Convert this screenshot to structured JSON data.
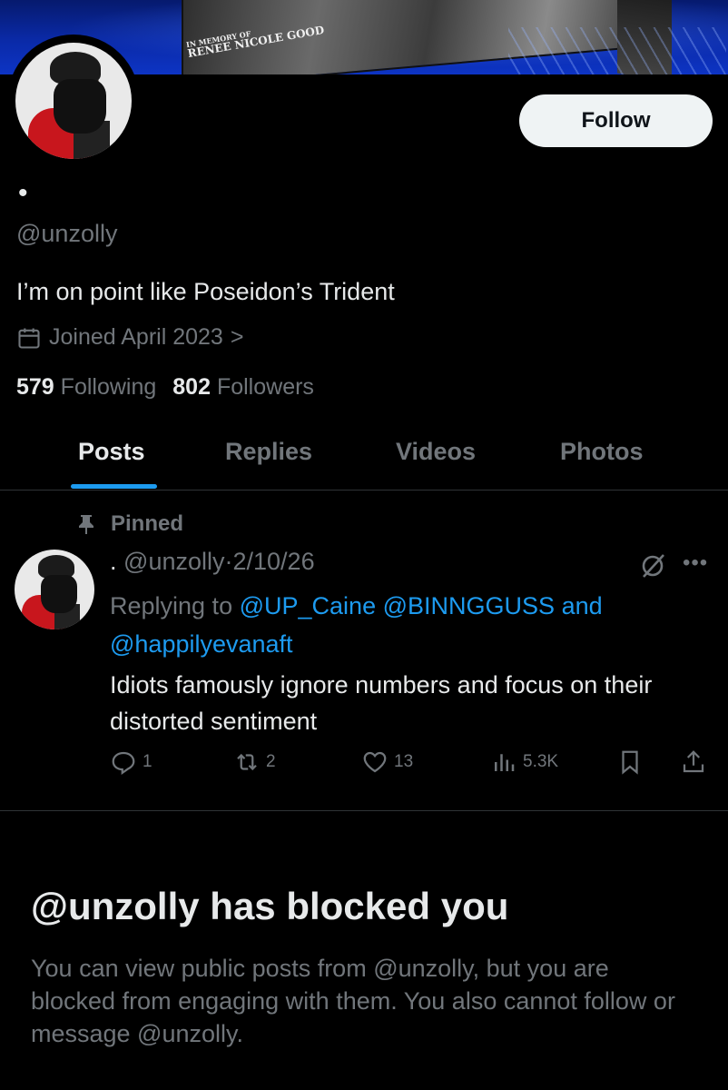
{
  "banner": {
    "memorial_line1": "IN MEMORY OF",
    "memorial_line2": "RENEE NICOLE GOOD"
  },
  "profile": {
    "display_name": "•",
    "handle": "@unzolly",
    "bio": "I’m on point like Poseidon’s Trident",
    "joined": "Joined April 2023",
    "joined_chevron": ">",
    "following_count": "579",
    "following_label": "Following",
    "followers_count": "802",
    "followers_label": "Followers",
    "follow_label": "Follow"
  },
  "tabs": [
    {
      "label": "Posts",
      "active": true
    },
    {
      "label": "Replies",
      "active": false
    },
    {
      "label": "Videos",
      "active": false
    },
    {
      "label": "Photos",
      "active": false
    }
  ],
  "pinned_post": {
    "pinned_label": "Pinned",
    "author_name": ".",
    "author_handle": "@unzolly",
    "separator": "·",
    "date": "2/10/26",
    "replying_prefix": "Replying to",
    "mention1": "@UP_Caine",
    "mention2": "@BINNGGUSS",
    "and_word": "and",
    "mention3": "@happilyevanaft",
    "text": "Idiots famously ignore numbers and focus on their distorted sentiment",
    "replies": "1",
    "reposts": "2",
    "likes": "13",
    "views": "5.3K",
    "more": "•••"
  },
  "blocked": {
    "title": "@unzolly has blocked you",
    "message": "You can view public posts from @unzolly, but you are blocked from engaging with them. You also cannot follow or message @unzolly."
  },
  "colors": {
    "background": "#000000",
    "accent": "#1d9bf0",
    "muted": "#71767b",
    "text": "#e7e9ea"
  }
}
